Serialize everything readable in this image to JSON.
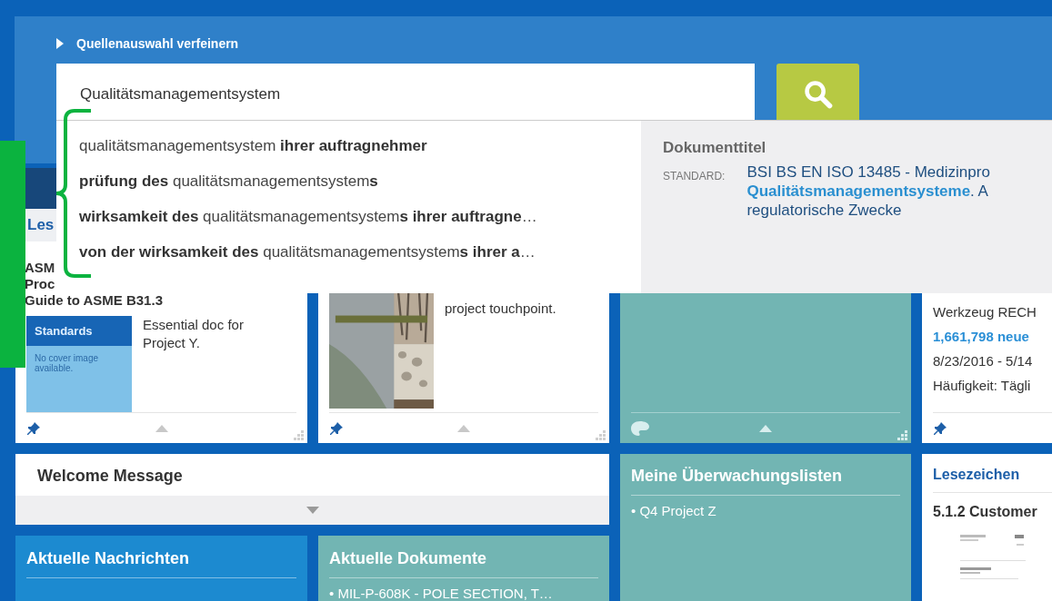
{
  "header": {
    "refine_label": "Quellenauswahl verfeinern",
    "search": {
      "value": "Qualitätsmanagementsystem"
    }
  },
  "suggestions": [
    {
      "text": "qualitätsmanagementsystem **ihrer auftragnehmer**"
    },
    {
      "text": "**prüfung des** qualitätsmanagementsystem**s**"
    },
    {
      "text": "**wirksamkeit des** qualitätsmanagementsystem**s ihrer auftragne**…"
    },
    {
      "text": "**von der wirksamkeit des** qualitätsmanagementsystem**s ihrer a**…"
    }
  ],
  "preview": {
    "heading": "Dokumenttitel",
    "type_label": "STANDARD:",
    "lines": [
      "BSI BS EN ISO 13485 - Medizinpro",
      "**Qualitätsmanagementsysteme**. A",
      "regulatorische Zwecke"
    ]
  },
  "cards": [
    {
      "kind": "document",
      "tab": "Les",
      "title_lines": [
        "ASM",
        "Proc",
        "Guide to ASME B31.3"
      ],
      "cover": {
        "kind": "placeholder",
        "label": "Standards",
        "note": "No cover image available."
      },
      "note": "Essential doc for Project Y."
    },
    {
      "kind": "document",
      "note": "project touchpoint."
    },
    {
      "kind": "empty"
    },
    {
      "kind": "alert",
      "lines": [
        {
          "text": "Werkzeug RECH",
          "highlight": false
        },
        {
          "text": "1,661,798 neue",
          "highlight": true
        },
        {
          "text": "8/23/2016 - 5/14",
          "highlight": false
        },
        {
          "text": "Häufigkeit: Tägli",
          "highlight": false
        }
      ]
    }
  ],
  "welcome": {
    "title": "Welcome Message"
  },
  "watchlists": {
    "title": "Meine Überwachungslisten",
    "items": [
      "• Q4 Project Z"
    ]
  },
  "bookmarks": {
    "title": "Lesezeichen",
    "items": [
      "5.1.2 Customer"
    ]
  },
  "news": {
    "title": "Aktuelle Nachrichten"
  },
  "documents": {
    "title": "Aktuelle Dokumente",
    "items": [
      "• MIL-P-608K - POLE SECTION, T…"
    ]
  }
}
